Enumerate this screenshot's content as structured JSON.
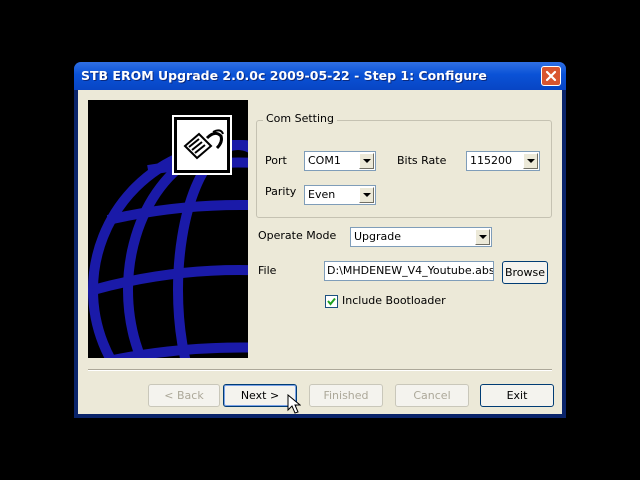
{
  "window": {
    "title": "STB EROM Upgrade 2.0.0c 2009-05-22 - Step 1: Configure"
  },
  "com_setting": {
    "legend": "Com Setting",
    "port_label": "Port",
    "port_value": "COM1",
    "bits_rate_label": "Bits Rate",
    "bits_rate_value": "115200",
    "parity_label": "Parity",
    "parity_value": "Even"
  },
  "operate_mode": {
    "label": "Operate Mode",
    "value": "Upgrade"
  },
  "file": {
    "label": "File",
    "value": "D:\\MHDENEW_V4_Youtube.abs",
    "browse_label": "Browse"
  },
  "bootloader": {
    "label": "Include Bootloader",
    "checked": true
  },
  "buttons": {
    "back": "< Back",
    "next": "Next >",
    "finished": "Finished",
    "cancel": "Cancel",
    "exit": "Exit"
  },
  "icons": [
    "close-icon",
    "network-cable-icon",
    "globe-graphic",
    "checkmark-icon",
    "dropdown-arrow-icon",
    "mouse-cursor-icon"
  ],
  "colors": {
    "titlebar": "#0a52d6",
    "dialog_bg": "#ece9d8",
    "globe": "#1a1aa8"
  }
}
